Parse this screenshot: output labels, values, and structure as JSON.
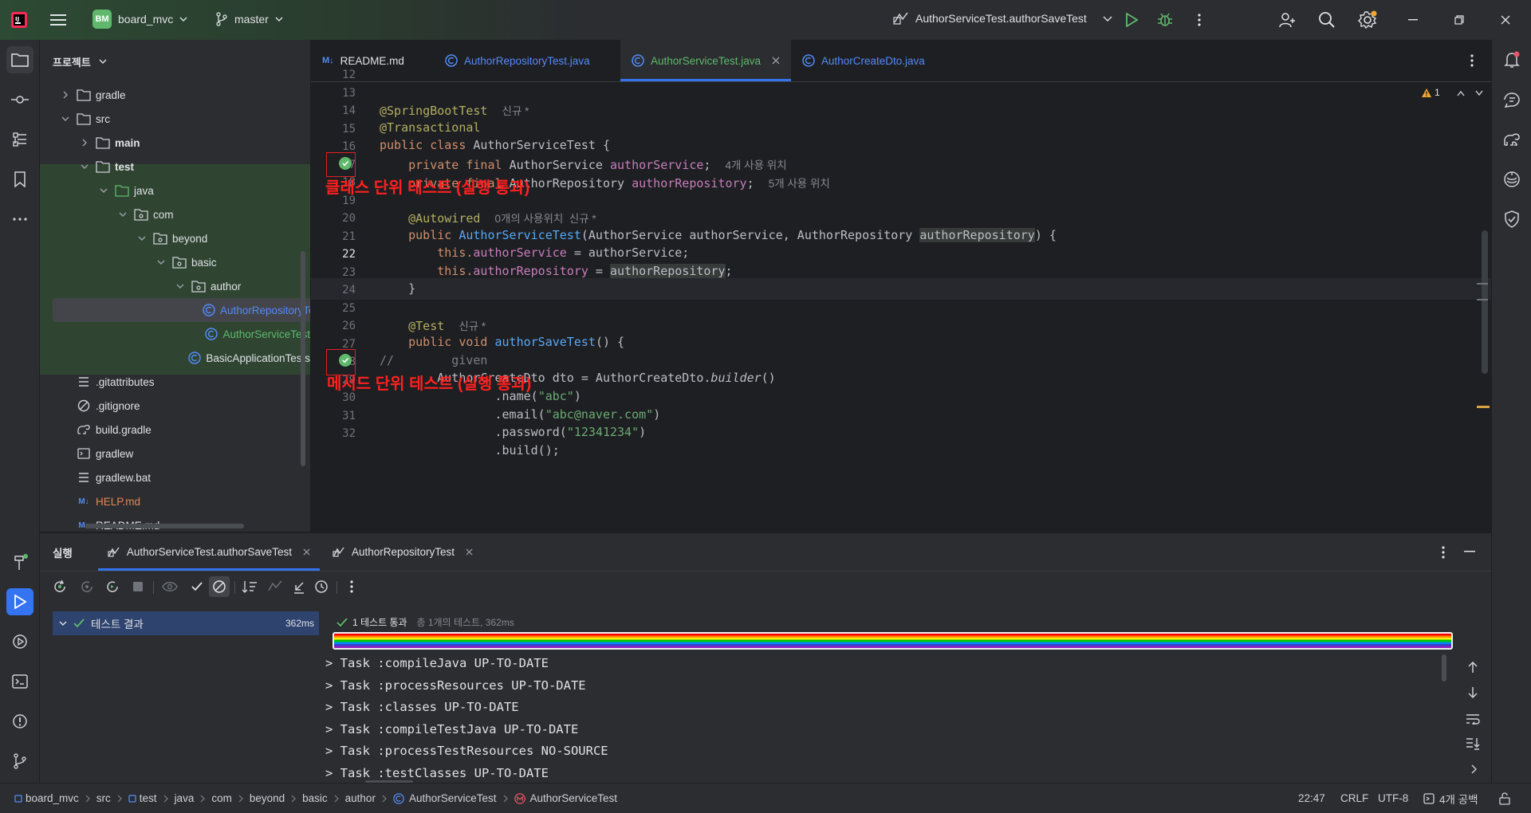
{
  "titlebar": {
    "project_badge": "BM",
    "project_name": "board_mvc",
    "branch": "master",
    "run_config": "AuthorServiceTest.authorSaveTest"
  },
  "project_panel": {
    "title": "프로젝트",
    "tree": [
      {
        "label": "gradle",
        "type": "folder",
        "depth": 1,
        "chevron": "right"
      },
      {
        "label": "src",
        "type": "folder",
        "depth": 1,
        "chevron": "down"
      },
      {
        "label": "main",
        "type": "folder",
        "depth": 2,
        "chevron": "right",
        "bold": true
      },
      {
        "label": "test",
        "type": "folder",
        "depth": 2,
        "chevron": "down",
        "bold": true
      },
      {
        "label": "java",
        "type": "folder-green",
        "depth": 3,
        "chevron": "down"
      },
      {
        "label": "com",
        "type": "package",
        "depth": 4,
        "chevron": "down"
      },
      {
        "label": "beyond",
        "type": "package",
        "depth": 5,
        "chevron": "down"
      },
      {
        "label": "basic",
        "type": "package",
        "depth": 6,
        "chevron": "down"
      },
      {
        "label": "author",
        "type": "package",
        "depth": 7,
        "chevron": "down"
      },
      {
        "label": "AuthorRepositoryTest",
        "type": "class",
        "depth": 8,
        "color": "#548af7",
        "selected": true
      },
      {
        "label": "AuthorServiceTest",
        "type": "class",
        "depth": 8,
        "color": "#5fb86c"
      },
      {
        "label": "BasicApplicationTests",
        "type": "class",
        "depth": 7
      },
      {
        "label": ".gitattributes",
        "type": "text",
        "depth": 1
      },
      {
        "label": ".gitignore",
        "type": "ignore",
        "depth": 1
      },
      {
        "label": "build.gradle",
        "type": "gradle",
        "depth": 1
      },
      {
        "label": "gradlew",
        "type": "shell",
        "depth": 1
      },
      {
        "label": "gradlew.bat",
        "type": "text",
        "depth": 1
      },
      {
        "label": "HELP.md",
        "type": "md",
        "depth": 1,
        "color": "#e08855"
      },
      {
        "label": "README.md",
        "type": "md",
        "depth": 1
      }
    ]
  },
  "editor": {
    "tabs": [
      {
        "label": "README.md",
        "icon": "M↓",
        "active": false,
        "color": "#dfe1e5"
      },
      {
        "label": "AuthorRepositoryTest.java",
        "icon": "class",
        "active": false,
        "color": "#548af7"
      },
      {
        "label": "AuthorServiceTest.java",
        "icon": "class",
        "active": true,
        "color": "#5fb86c"
      },
      {
        "label": "AuthorCreateDto.java",
        "icon": "class",
        "active": false,
        "color": "#548af7"
      }
    ],
    "warning_count": "1",
    "line_numbers": [
      "12",
      "13",
      "14",
      "15",
      "16",
      "17",
      "18",
      "19",
      "20",
      "21",
      "22",
      "23",
      "24",
      "25",
      "26",
      "27",
      "28",
      "29",
      "30",
      "31",
      "32"
    ],
    "code": {
      "l13_ann": "@SpringBootTest",
      "l13_hint": "신규 *",
      "l14_ann": "@Transactional",
      "l15_kw": "public class ",
      "l15_name": "AuthorServiceTest {",
      "l16_kw": "private final ",
      "l16_type": "AuthorService ",
      "l16_field": "authorService",
      "l16_semi": ";",
      "l16_hint": "4개 사용 위치",
      "l17_kw": "private final ",
      "l17_type": "AuthorRepository ",
      "l17_field": "authorRepository",
      "l17_semi": ";",
      "l17_hint": "5개 사용 위치",
      "l19_ann": "@Autowired",
      "l19_hint": "0개의 사용위치  신규 *",
      "l20_kw": "public ",
      "l20_fn": "AuthorServiceTest",
      "l20_params": "(AuthorService authorService, AuthorRepository ",
      "l20_hlparam": "authorRepository",
      "l20_end": ") {",
      "l21_this": "this.",
      "l21_field": "authorService",
      "l21_rest": " = authorService;",
      "l22_this": "this.",
      "l22_field": "authorRepository",
      "l22_eq": " = ",
      "l22_hl": "authorRepository",
      "l22_semi": ";",
      "l23": "}",
      "l25_ann": "@Test",
      "l25_hint": "신규 *",
      "l26_kw": "public void ",
      "l26_fn": "authorSaveTest",
      "l26_end": "() {",
      "l27_cm": "//        given",
      "l28_a": "AuthorCreateDto dto = AuthorCreateDto.",
      "l28_b": "builder",
      "l28_c": "()",
      "l29_a": ".name(",
      "l29_s": "\"abc\"",
      "l29_b": ")",
      "l30_a": ".email(",
      "l30_s": "\"abc@naver.com\"",
      "l30_b": ")",
      "l31_a": ".password(",
      "l31_s": "\"12341234\"",
      "l31_b": ")",
      "l32": ".build();"
    },
    "annotations": {
      "class_test": "클래스 단위 테스트 (실행 통과)",
      "method_test": "메서드 단위 테스트 (실행 통과)"
    }
  },
  "run_panel": {
    "title": "실행",
    "tabs": [
      {
        "label": "AuthorServiceTest.authorSaveTest",
        "active": true
      },
      {
        "label": "AuthorRepositoryTest",
        "active": false
      }
    ],
    "tree_result": {
      "label": "테스트 결과",
      "time": "362ms"
    },
    "summary_pass": "1 테스트 통과",
    "summary_detail": "총 1개의 테스트, 362ms",
    "console_lines": [
      "> Task :compileJava UP-TO-DATE",
      "> Task :processResources UP-TO-DATE",
      "> Task :classes UP-TO-DATE",
      "> Task :compileTestJava UP-TO-DATE",
      "> Task :processTestResources NO-SOURCE",
      "> Task :testClasses UP-TO-DATE"
    ]
  },
  "statusbar": {
    "breadcrumbs": [
      "board_mvc",
      "src",
      "test",
      "java",
      "com",
      "beyond",
      "basic",
      "author",
      "AuthorServiceTest",
      "AuthorServiceTest"
    ],
    "time": "22:47",
    "line_ending": "CRLF",
    "encoding": "UTF-8",
    "indent": "4개 공백"
  }
}
